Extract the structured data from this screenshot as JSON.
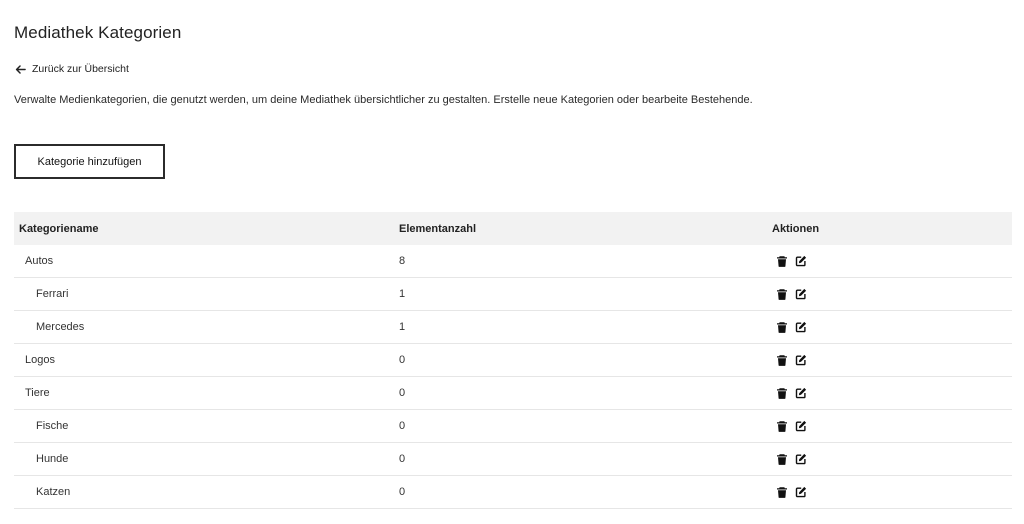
{
  "page": {
    "title": "Mediathek Kategorien",
    "back_label": "Zurück zur Übersicht",
    "description": "Verwalte Medienkategorien, die genutzt werden, um deine Mediathek übersichtlicher zu gestalten. Erstelle neue Kategorien oder bearbeite Bestehende.",
    "add_button_label": "Kategorie hinzufügen"
  },
  "table": {
    "headers": {
      "name": "Kategoriename",
      "count": "Elementanzahl",
      "actions": "Aktionen"
    },
    "rows": [
      {
        "name": "Autos",
        "count": "8",
        "child": false
      },
      {
        "name": "Ferrari",
        "count": "1",
        "child": true
      },
      {
        "name": "Mercedes",
        "count": "1",
        "child": true
      },
      {
        "name": "Logos",
        "count": "0",
        "child": false
      },
      {
        "name": "Tiere",
        "count": "0",
        "child": false
      },
      {
        "name": "Fische",
        "count": "0",
        "child": true
      },
      {
        "name": "Hunde",
        "count": "0",
        "child": true
      },
      {
        "name": "Katzen",
        "count": "0",
        "child": true
      }
    ],
    "row_actions": [
      "trash-icon",
      "edit-icon"
    ]
  }
}
